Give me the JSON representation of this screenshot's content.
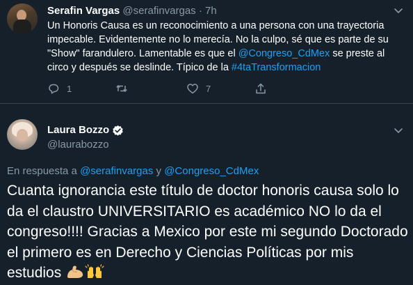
{
  "tweet1": {
    "name": "Serafin Vargas",
    "handle": "@serafinvargas",
    "separator": "·",
    "time": "7h",
    "text_a": "Un Honoris Causa es un reconocimiento a una persona con una trayectoria impecable. Evidentemente no lo merecía. No la culpo, sé que es parte de su \"Show\" farandulero.  Lamentable es que el  ",
    "mention": "@Congreso_CdMex",
    "text_b": " se preste al circo y después se deslinde. Típico de la ",
    "hashtag": "#4taTransformacion",
    "reply_count": "1",
    "retweet_count": "",
    "like_count": "7"
  },
  "tweet2": {
    "name": "Laura Bozzo",
    "handle": "@laurabozzo",
    "reply_prefix": "En respuesta a ",
    "reply_user1": "@serafinvargas",
    "reply_and": " y ",
    "reply_user2": "@Congreso_CdMex",
    "text": "Cuanta ignorancia este título de doctor honoris causa solo lo da el claustro UNIVERSITARIO es académico NO  lo da el congreso!!!! Gracias a Mexico por este mi segundo Doctorado el primero es en Derecho y Ciencias Políticas por mis estudios "
  },
  "colors": {
    "background": "#15202b",
    "link": "#1da1f2",
    "secondary_text": "#8899a6",
    "divider": "#38444d"
  },
  "icons": [
    "reply-icon",
    "retweet-icon",
    "like-icon",
    "share-icon",
    "chevron-down-icon",
    "verified-badge-icon",
    "flexed-biceps-emoji",
    "raising-hands-emoji"
  ]
}
